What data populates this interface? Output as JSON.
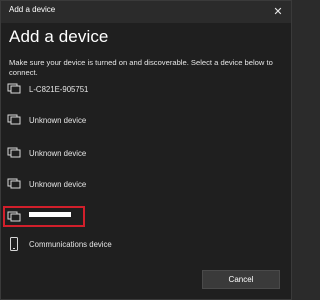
{
  "window": {
    "title": "Add a device",
    "close_glyph": "✕"
  },
  "heading": "Add a device",
  "instructions": "Make sure your device is turned on and discoverable. Select a device below to connect.",
  "devices": [
    {
      "label": "L-C821E-905751",
      "icon": "display-icon"
    },
    {
      "label": "Unknown device",
      "icon": "display-icon"
    },
    {
      "label": "Unknown device",
      "icon": "display-icon"
    },
    {
      "label": "Unknown device",
      "icon": "display-icon"
    },
    {
      "label": "",
      "icon": "display-icon",
      "redacted": true,
      "highlighted": true,
      "highlight_color": "#d21f2b"
    },
    {
      "label": "Communications device",
      "icon": "phone-icon"
    }
  ],
  "buttons": {
    "cancel": "Cancel"
  }
}
